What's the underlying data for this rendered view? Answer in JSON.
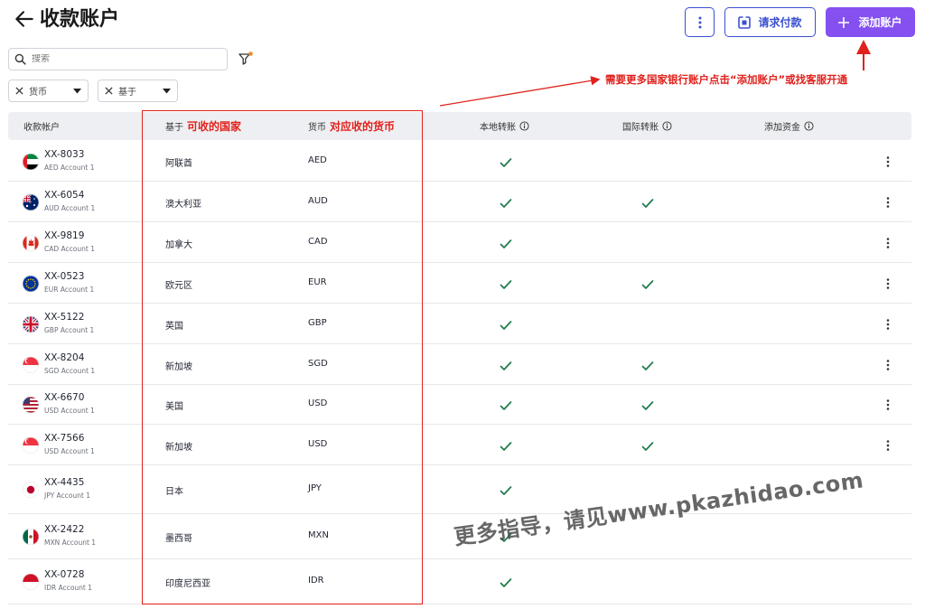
{
  "header": {
    "title": "收款账户",
    "request_payment_label": "请求付款",
    "add_account_label": "添加账户"
  },
  "search": {
    "placeholder": "搜索"
  },
  "filters": [
    {
      "label": "货币"
    },
    {
      "label": "基于"
    }
  ],
  "annotations": {
    "add_account_tip": "需要更多国家银行账户点击“添加账户”或找客服开通",
    "based_on_tip": "可收的国家",
    "currency_tip": "对应收的货币",
    "watermark": "更多指导，请见www.pkazhidao.com"
  },
  "table": {
    "headers": {
      "account": "收款帐户",
      "based_on": "基于",
      "currency": "货币",
      "local_transfer": "本地转账",
      "intl_transfer": "国际转账",
      "add_funds": "添加资金"
    },
    "rows": [
      {
        "id": "XX-8033",
        "name": "AED Account 1",
        "country": "阿联酋",
        "currency": "AED",
        "local": true,
        "intl": false,
        "flag": "ae"
      },
      {
        "id": "XX-6054",
        "name": "AUD Account 1",
        "country": "澳大利亚",
        "currency": "AUD",
        "local": true,
        "intl": true,
        "flag": "au"
      },
      {
        "id": "XX-9819",
        "name": "CAD Account 1",
        "country": "加拿大",
        "currency": "CAD",
        "local": true,
        "intl": false,
        "flag": "ca"
      },
      {
        "id": "XX-0523",
        "name": "EUR Account 1",
        "country": "欧元区",
        "currency": "EUR",
        "local": true,
        "intl": true,
        "flag": "eu"
      },
      {
        "id": "XX-5122",
        "name": "GBP Account 1",
        "country": "英国",
        "currency": "GBP",
        "local": true,
        "intl": false,
        "flag": "gb"
      },
      {
        "id": "XX-8204",
        "name": "SGD Account 1",
        "country": "新加坡",
        "currency": "SGD",
        "local": true,
        "intl": true,
        "flag": "sg"
      },
      {
        "id": "XX-6670",
        "name": "USD Account 1",
        "country": "美国",
        "currency": "USD",
        "local": true,
        "intl": true,
        "flag": "us"
      },
      {
        "id": "XX-7566",
        "name": "USD Account 1",
        "country": "新加坡",
        "currency": "USD",
        "local": true,
        "intl": true,
        "flag": "sg"
      },
      {
        "id": "XX-4435",
        "name": "JPY Account 1",
        "country": "日本",
        "currency": "JPY",
        "local": true,
        "intl": false,
        "flag": "jp"
      },
      {
        "id": "XX-2422",
        "name": "MXN Account 1",
        "country": "墨西哥",
        "currency": "MXN",
        "local": true,
        "intl": false,
        "flag": "mx"
      },
      {
        "id": "XX-0728",
        "name": "IDR Account 1",
        "country": "印度尼西亚",
        "currency": "IDR",
        "local": true,
        "intl": false,
        "flag": "id"
      }
    ]
  },
  "colors": {
    "accent": "#3a4fd0",
    "primary_button": "#8450f0",
    "check": "#1e7a4a",
    "annotation": "#e0211c",
    "filter_dot": "#f08a24"
  }
}
